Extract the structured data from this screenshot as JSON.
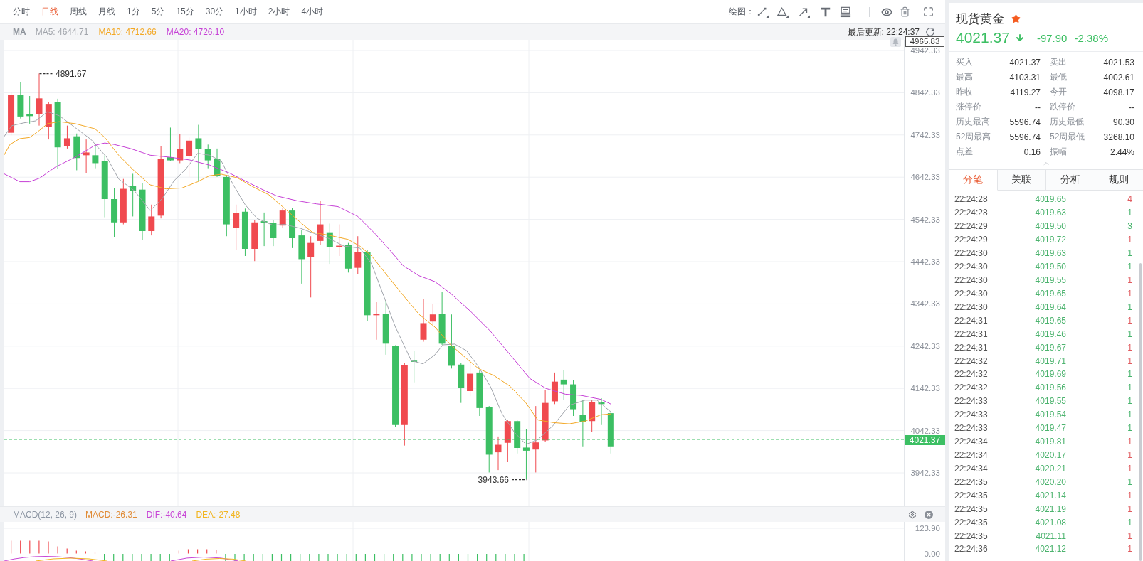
{
  "toolbar": {
    "periods": [
      {
        "label": "分时",
        "selected": false
      },
      {
        "label": "日线",
        "selected": true
      },
      {
        "label": "周线",
        "selected": false
      },
      {
        "label": "月线",
        "selected": false
      },
      {
        "label": "1分",
        "selected": false
      },
      {
        "label": "5分",
        "selected": false
      },
      {
        "label": "15分",
        "selected": false
      },
      {
        "label": "30分",
        "selected": false
      },
      {
        "label": "1小时",
        "selected": false
      },
      {
        "label": "2小时",
        "selected": false
      },
      {
        "label": "4小时",
        "selected": false
      }
    ],
    "draw_label": "绘图："
  },
  "legend": {
    "title": "MA",
    "items": [
      {
        "label": "MA5: 4644.71",
        "color": "#a0a4ab"
      },
      {
        "label": "MA10: 4712.66",
        "color": "#f3a825"
      },
      {
        "label": "MA20: 4726.10",
        "color": "#c640d6"
      }
    ],
    "updated": "最后更新: 22:24:37"
  },
  "chart": {
    "top_tag": "4965.83",
    "y_ticks": [
      "4942.33",
      "4842.33",
      "4742.33",
      "4642.33",
      "4542.33",
      "4442.33",
      "4342.33",
      "4242.33",
      "4142.33",
      "4042.33",
      "3942.33"
    ],
    "high_label": "4891.67",
    "low_label": "3943.66",
    "price_tag": "4021.37"
  },
  "macd": {
    "title": "MACD(12, 26, 9)",
    "values": [
      {
        "label": "MACD:-26.31",
        "color": "#e08b35"
      },
      {
        "label": "DIF:-40.64",
        "color": "#c846d6"
      },
      {
        "label": "DEA:-27.48",
        "color": "#f2b520"
      }
    ],
    "y_ticks": [
      "123.90",
      "0.00"
    ]
  },
  "quote": {
    "name": "现货黄金",
    "favorite": true,
    "falling": true,
    "price": "4021.37",
    "change": "-97.90",
    "change_pct": "-2.38%",
    "stats": [
      {
        "label": "买入",
        "value": "4021.37"
      },
      {
        "label": "卖出",
        "value": "4021.53"
      },
      {
        "label": "最高",
        "value": "4103.31"
      },
      {
        "label": "最低",
        "value": "4002.61"
      },
      {
        "label": "昨收",
        "value": "4119.27"
      },
      {
        "label": "今开",
        "value": "4098.17"
      },
      {
        "label": "涨停价",
        "value": "--"
      },
      {
        "label": "跌停价",
        "value": "--"
      },
      {
        "label": "历史最高",
        "value": "5596.74"
      },
      {
        "label": "历史最低",
        "value": "90.30"
      },
      {
        "label": "52周最高",
        "value": "5596.74"
      },
      {
        "label": "52周最低",
        "value": "3268.10"
      },
      {
        "label": "点差",
        "value": "0.16"
      },
      {
        "label": "振幅",
        "value": "2.44%"
      }
    ]
  },
  "info_tabs": [
    {
      "label": "分笔",
      "selected": true
    },
    {
      "label": "关联",
      "selected": false
    },
    {
      "label": "分析",
      "selected": false
    },
    {
      "label": "规则",
      "selected": false
    }
  ],
  "trades": [
    {
      "time": "22:24:28",
      "price": "4019.65",
      "volume": "4",
      "color": "#e05a5e"
    },
    {
      "time": "22:24:28",
      "price": "4019.63",
      "volume": "1",
      "color": "#45b36b"
    },
    {
      "time": "22:24:29",
      "price": "4019.50",
      "volume": "3",
      "color": "#45b36b"
    },
    {
      "time": "22:24:29",
      "price": "4019.72",
      "volume": "1",
      "color": "#e05a5e"
    },
    {
      "time": "22:24:30",
      "price": "4019.63",
      "volume": "1",
      "color": "#45b36b"
    },
    {
      "time": "22:24:30",
      "price": "4019.50",
      "volume": "1",
      "color": "#45b36b"
    },
    {
      "time": "22:24:30",
      "price": "4019.55",
      "volume": "1",
      "color": "#e05a5e"
    },
    {
      "time": "22:24:30",
      "price": "4019.65",
      "volume": "1",
      "color": "#e05a5e"
    },
    {
      "time": "22:24:30",
      "price": "4019.64",
      "volume": "1",
      "color": "#45b36b"
    },
    {
      "time": "22:24:31",
      "price": "4019.65",
      "volume": "1",
      "color": "#e05a5e"
    },
    {
      "time": "22:24:31",
      "price": "4019.46",
      "volume": "1",
      "color": "#45b36b"
    },
    {
      "time": "22:24:31",
      "price": "4019.67",
      "volume": "1",
      "color": "#e05a5e"
    },
    {
      "time": "22:24:32",
      "price": "4019.71",
      "volume": "1",
      "color": "#e05a5e"
    },
    {
      "time": "22:24:32",
      "price": "4019.69",
      "volume": "1",
      "color": "#45b36b"
    },
    {
      "time": "22:24:32",
      "price": "4019.56",
      "volume": "1",
      "color": "#45b36b"
    },
    {
      "time": "22:24:33",
      "price": "4019.55",
      "volume": "1",
      "color": "#45b36b"
    },
    {
      "time": "22:24:33",
      "price": "4019.54",
      "volume": "1",
      "color": "#45b36b"
    },
    {
      "time": "22:24:33",
      "price": "4019.47",
      "volume": "1",
      "color": "#45b36b"
    },
    {
      "time": "22:24:34",
      "price": "4019.81",
      "volume": "1",
      "color": "#e05a5e"
    },
    {
      "time": "22:24:34",
      "price": "4020.17",
      "volume": "1",
      "color": "#e05a5e"
    },
    {
      "time": "22:24:34",
      "price": "4020.21",
      "volume": "1",
      "color": "#e05a5e"
    },
    {
      "time": "22:24:35",
      "price": "4020.20",
      "volume": "1",
      "color": "#45b36b"
    },
    {
      "time": "22:24:35",
      "price": "4021.14",
      "volume": "1",
      "color": "#e05a5e"
    },
    {
      "time": "22:24:35",
      "price": "4021.19",
      "volume": "1",
      "color": "#e05a5e"
    },
    {
      "time": "22:24:35",
      "price": "4021.08",
      "volume": "1",
      "color": "#45b36b"
    },
    {
      "time": "22:24:35",
      "price": "4021.11",
      "volume": "1",
      "color": "#e05a5e"
    },
    {
      "time": "22:24:36",
      "price": "4021.12",
      "volume": "1",
      "color": "#e05a5e"
    }
  ]
}
